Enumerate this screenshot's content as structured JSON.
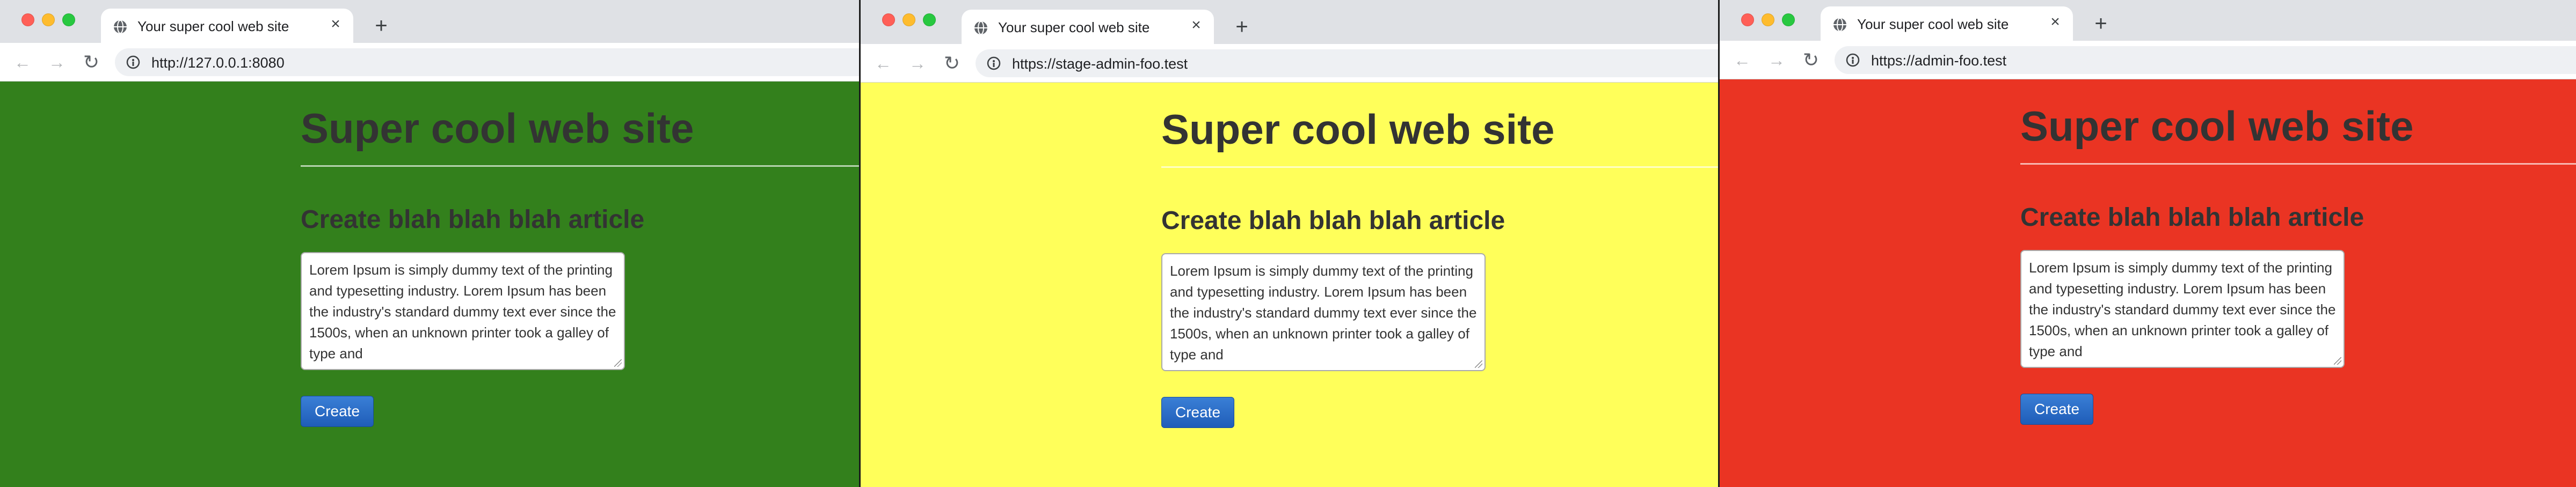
{
  "windows": [
    {
      "tab_title": "Your super cool web site",
      "url": "http://127.0.0.1:8080",
      "page_background": "#33801c",
      "site_title": "Super cool web site",
      "heading": "Create blah blah blah article",
      "textarea_value": "Lorem Ipsum is simply dummy text of the printing and typesetting industry. Lorem Ipsum has been the industry's standard dummy text ever since the 1500s, when an unknown printer took a galley of type and",
      "create_label": "Create"
    },
    {
      "tab_title": "Your super cool web site",
      "url": "https://stage-admin-foo.test",
      "page_background": "#ffff5a",
      "site_title": "Super cool web site",
      "heading": "Create blah blah blah article",
      "textarea_value": "Lorem Ipsum is simply dummy text of the printing and typesetting industry. Lorem Ipsum has been the industry's standard dummy text ever since the 1500s, when an unknown printer took a galley of type and",
      "create_label": "Create"
    },
    {
      "tab_title": "Your super cool web site",
      "url": "https://admin-foo.test",
      "page_background": "#ea3423",
      "site_title": "Super cool web site",
      "heading": "Create blah blah blah article",
      "textarea_value": "Lorem Ipsum is simply dummy text of the printing and typesetting industry. Lorem Ipsum has been the industry's standard dummy text ever since the 1500s, when an unknown printer took a galley of type and",
      "create_label": "Create"
    }
  ],
  "icons": {
    "tab_favicon": "globe-icon",
    "tab_close": "close-icon",
    "new_tab": "plus-icon",
    "back": "arrow-left-icon",
    "forward": "arrow-right-icon",
    "reload": "reload-icon",
    "site_info": "site-info-icon"
  }
}
